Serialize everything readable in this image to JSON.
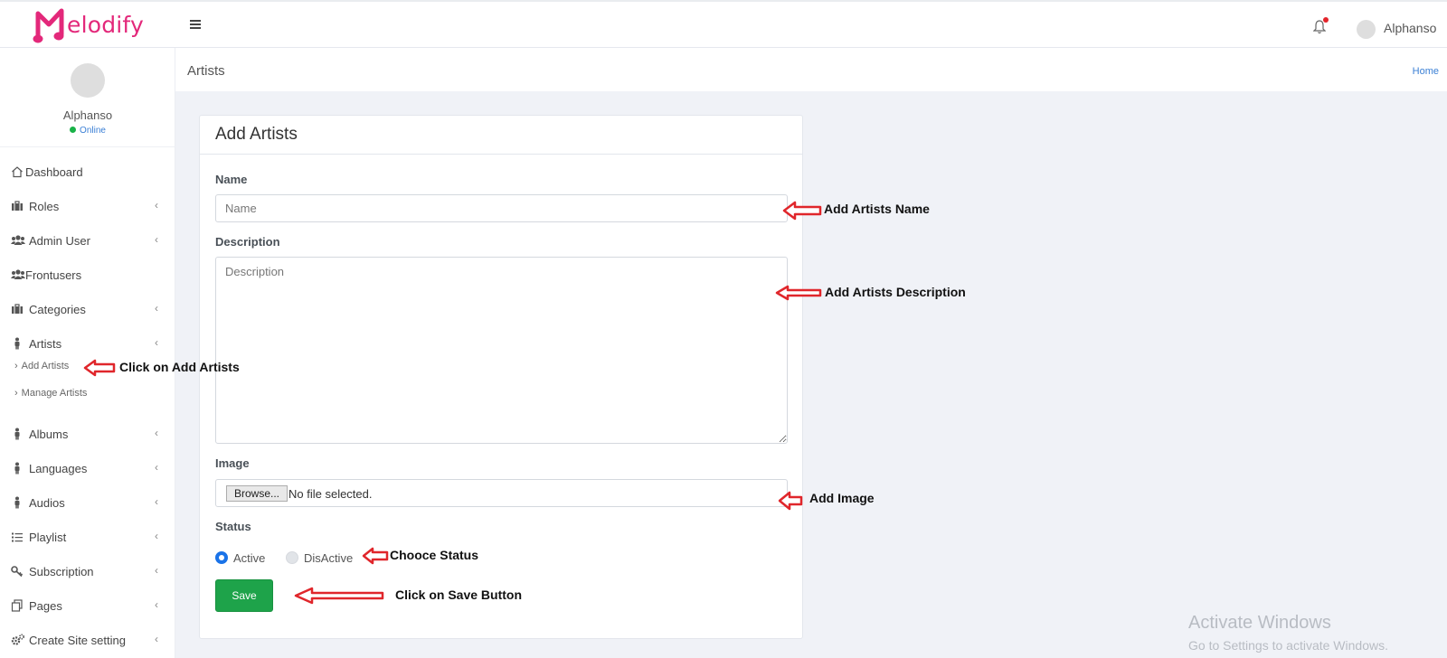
{
  "app": {
    "brand": "elodify",
    "user_name": "Alphanso"
  },
  "sidebar": {
    "profile_name": "Alphanso",
    "profile_status": "Online",
    "items": [
      {
        "label": "Dashboard",
        "icon": "home-icon",
        "chevron": false
      },
      {
        "label": "Roles",
        "icon": "briefcase-icon",
        "chevron": true
      },
      {
        "label": "Admin User",
        "icon": "users-icon",
        "chevron": true
      },
      {
        "label": "Frontusers",
        "icon": "users-icon",
        "chevron": false
      },
      {
        "label": "Categories",
        "icon": "briefcase-icon",
        "chevron": true
      },
      {
        "label": "Artists",
        "icon": "person-icon",
        "chevron": true
      },
      {
        "label": "Albums",
        "icon": "person-icon",
        "chevron": true
      },
      {
        "label": "Languages",
        "icon": "person-icon",
        "chevron": true
      },
      {
        "label": "Audios",
        "icon": "person-icon",
        "chevron": true
      },
      {
        "label": "Playlist",
        "icon": "list-icon",
        "chevron": true
      },
      {
        "label": "Subscription",
        "icon": "key-icon",
        "chevron": true
      },
      {
        "label": "Pages",
        "icon": "copy-icon",
        "chevron": true
      },
      {
        "label": "Create Site setting",
        "icon": "cogs-icon",
        "chevron": true
      }
    ],
    "chevron_glyph": "‹",
    "sub_items": [
      {
        "label": "Add Artists"
      },
      {
        "label": "Manage Artists"
      }
    ],
    "sub_glyph": "›"
  },
  "header": {
    "title": "Artists",
    "breadcrumb": "Home"
  },
  "form": {
    "card_title": "Add Artists",
    "name_label": "Name",
    "name_placeholder": "Name",
    "description_label": "Description",
    "description_placeholder": "Description",
    "image_label": "Image",
    "browse_label": "Browse...",
    "no_file": "No file selected.",
    "status_label": "Status",
    "status_options": [
      "Active",
      "DisActive"
    ],
    "status_selected": "Active",
    "save_label": "Save"
  },
  "annotations": {
    "name": "Add Artists Name",
    "description": "Add Artists Description",
    "click_add": "Click on Add Artists",
    "image": "Add Image",
    "status": "Chooce Status",
    "save": "Click on Save Button"
  },
  "watermark": {
    "title": "Activate Windows",
    "subtitle": "Go to Settings to activate Windows."
  },
  "colors": {
    "brand": "#e3287a",
    "accent": "#1a73e8",
    "save": "#1ea34a",
    "annotation_arrow": "#e0262b",
    "online": "#19b248"
  }
}
